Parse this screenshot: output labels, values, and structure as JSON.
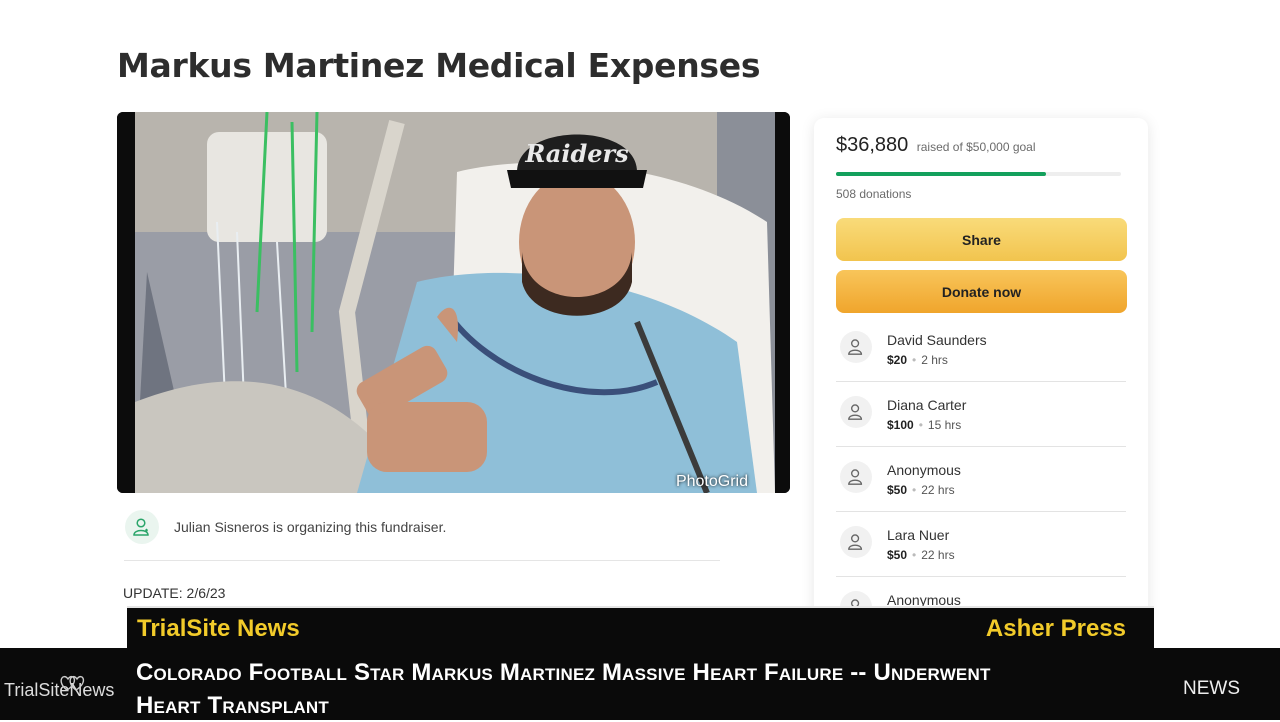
{
  "page": {
    "title": "Markus Martinez Medical Expenses"
  },
  "photo": {
    "watermark": "PhotoGrid",
    "cap_text": "Raiders"
  },
  "organizer": {
    "text": "Julian Sisneros is organizing this fundraiser."
  },
  "update": {
    "label": "UPDATE: 2/6/23"
  },
  "sidebar": {
    "raised_amount": "$36,880",
    "goal_text": "raised of $50,000 goal",
    "progress_fraction": 0.7376,
    "donations_count": "508 donations",
    "share_label": "Share",
    "donate_label": "Donate now",
    "donors": [
      {
        "name": "David Saunders",
        "amount": "$20",
        "time": "2 hrs"
      },
      {
        "name": "Diana Carter",
        "amount": "$100",
        "time": "15 hrs"
      },
      {
        "name": "Anonymous",
        "amount": "$50",
        "time": "22 hrs"
      },
      {
        "name": "Lara Nuer",
        "amount": "$50",
        "time": "22 hrs"
      },
      {
        "name": "Anonymous",
        "amount": "",
        "time": ""
      }
    ]
  },
  "lower_third": {
    "brand": "TrialSite News",
    "source": "Asher Press",
    "headline": "Colorado Football Star Markus Martinez Massive Heart Failure -- Underwent Heart Transplant",
    "logo_text": "TrialSiteNews",
    "news_label": "NEWS"
  },
  "colors": {
    "progress": "#13a05c",
    "share_button": "#f2c44e",
    "donate_button": "#f0a52c",
    "ticker_accent": "#f2cb2a"
  }
}
